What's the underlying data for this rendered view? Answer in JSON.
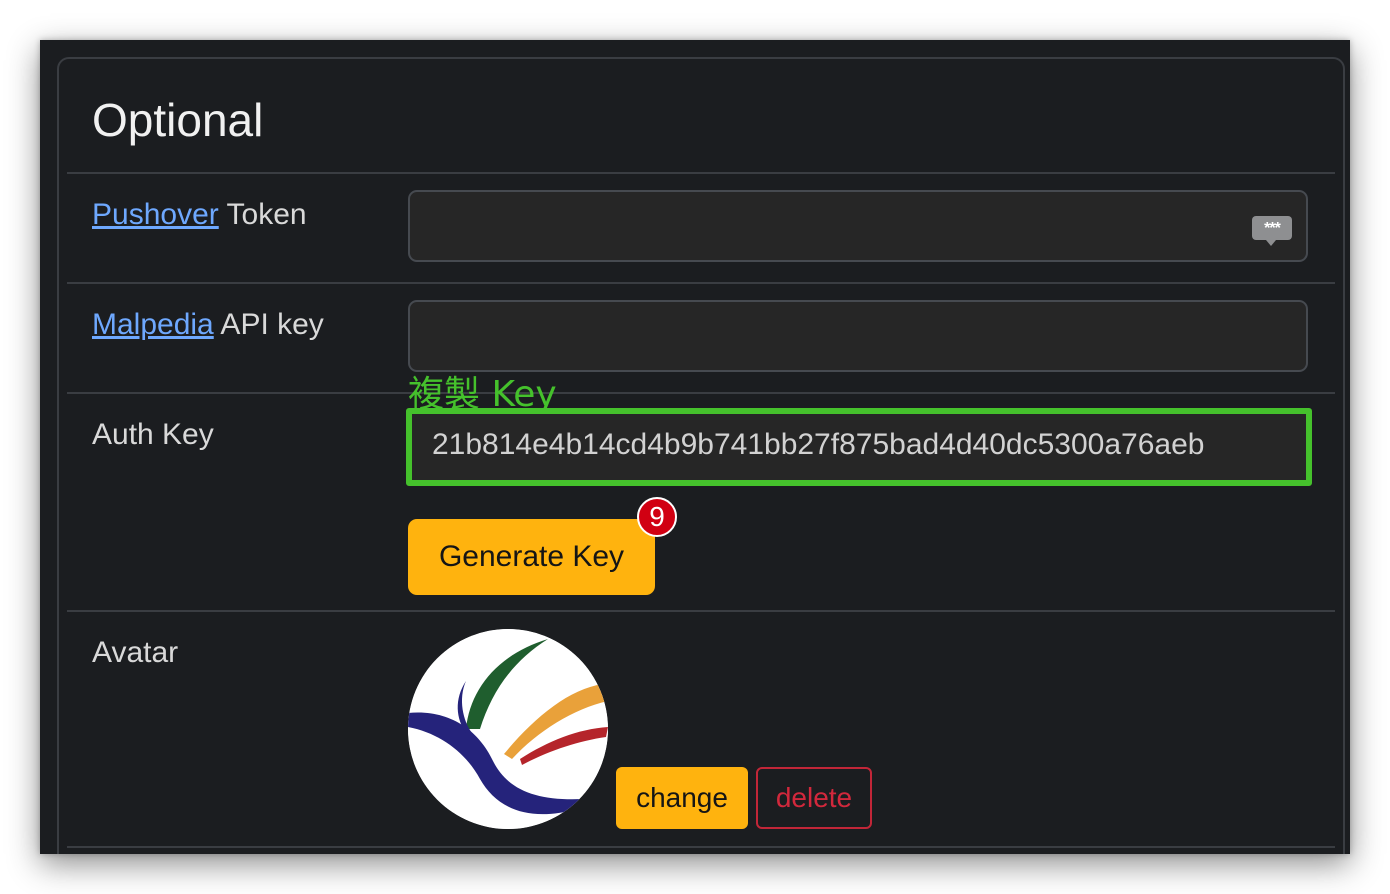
{
  "section": {
    "title": "Optional"
  },
  "pushover": {
    "link_text": "Pushover",
    "label_suffix": " Token",
    "value": "",
    "keyboard_icon_text": "***"
  },
  "malpedia": {
    "link_text": "Malpedia",
    "label_suffix": " API key",
    "value": ""
  },
  "annotation": {
    "text": "複製 Key",
    "color": "#45c12c"
  },
  "auth_key": {
    "label": "Auth Key",
    "value": "21b814e4b14cd4b9b741bb27f875bad4d40dc5300a76aeb",
    "generate_label": "Generate Key",
    "step_badge": "9"
  },
  "avatar": {
    "label": "Avatar",
    "change_label": "change",
    "delete_label": "delete"
  },
  "colors": {
    "background": "#1b1d20",
    "link": "#6ea8fe",
    "warning_button": "#ffb30e",
    "danger": "#d2283c",
    "badge": "#d10012"
  }
}
